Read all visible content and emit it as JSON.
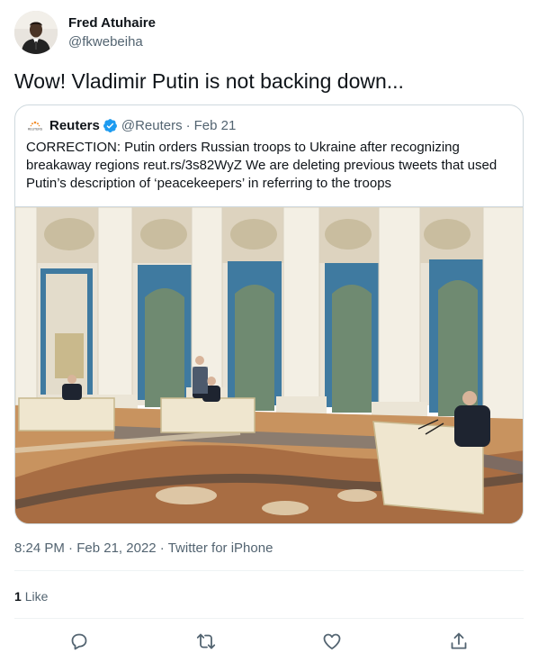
{
  "tweet": {
    "author_name": "Fred Atuhaire",
    "author_handle": "@fkwebeiha",
    "text": "Wow! Vladimir Putin is not backing down...",
    "timestamp": "8:24 PM",
    "date": "Feb 21, 2022",
    "client": "Twitter for iPhone",
    "likes_count": "1",
    "likes_label": "Like"
  },
  "quoted": {
    "name": "Reuters",
    "handle": "@Reuters",
    "date": "Feb 21",
    "logo_text": "REUTERS",
    "text_lines": [
      "CORRECTION: Putin orders Russian troops to Ukraine after recognizing",
      "breakaway regions reut.rs/3s82WyZ We are deleting previous tweets that used",
      "Putin’s description of ‘peacekeepers’ in referring to the troops"
    ]
  },
  "icons": {
    "reply": "reply-icon",
    "retweet": "retweet-icon",
    "like": "like-icon",
    "share": "share-icon",
    "verified": "verified-badge-icon"
  },
  "colors": {
    "text": "#0f1419",
    "secondary": "#536471",
    "border": "#cfd9de",
    "verified": "#1d9bf0"
  }
}
